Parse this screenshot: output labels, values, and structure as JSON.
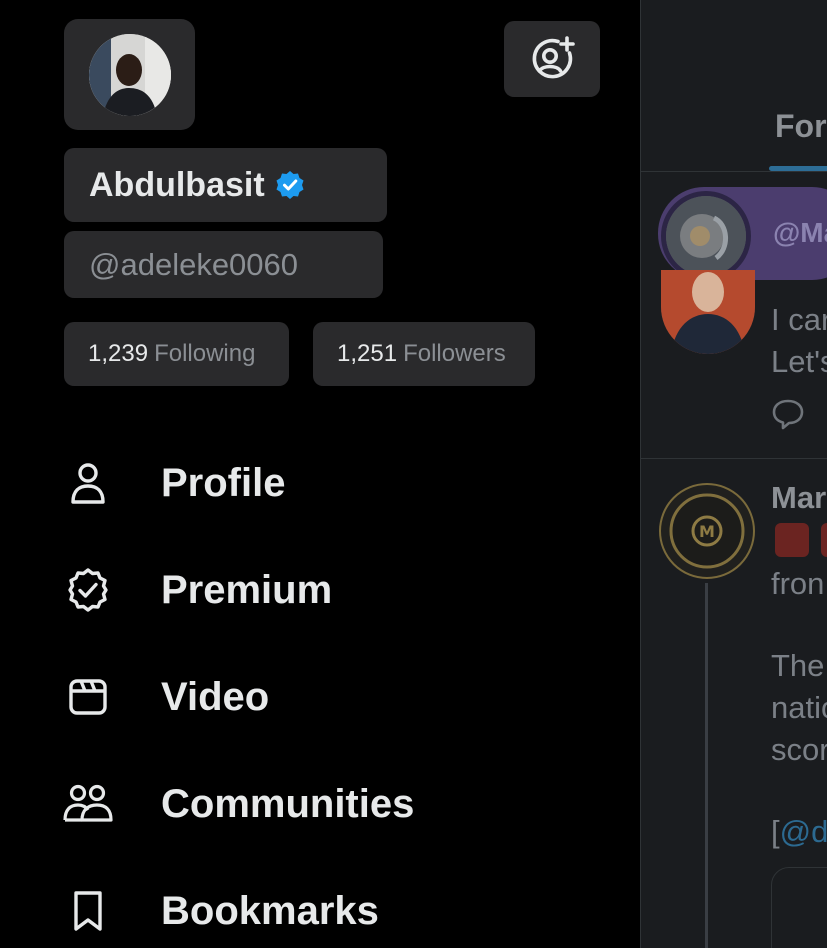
{
  "profile": {
    "name": "Abdulbasit",
    "handle": "@adeleke0060",
    "following_count": "1,239",
    "following_label": "Following",
    "followers_count": "1,251",
    "followers_label": "Followers"
  },
  "menu": [
    {
      "label": "Profile",
      "icon": "person-icon"
    },
    {
      "label": "Premium",
      "icon": "premium-badge-icon"
    },
    {
      "label": "Video",
      "icon": "video-icon"
    },
    {
      "label": "Communities",
      "icon": "communities-icon"
    },
    {
      "label": "Bookmarks",
      "icon": "bookmark-icon"
    }
  ],
  "background_timeline": {
    "tab": "For",
    "promo_handle": "@Ma",
    "post1_lines": [
      "I car",
      "Let's"
    ],
    "post2_author": "Mar",
    "post2_lines": [
      "fron",
      "The",
      "natio",
      "scor"
    ],
    "post2_link_bracket": "[",
    "post2_link": "@d"
  },
  "colors": {
    "accent_blue": "#1d9bf0",
    "drawer_bg": "#000000",
    "pill_bg": "#2a2a2c"
  }
}
